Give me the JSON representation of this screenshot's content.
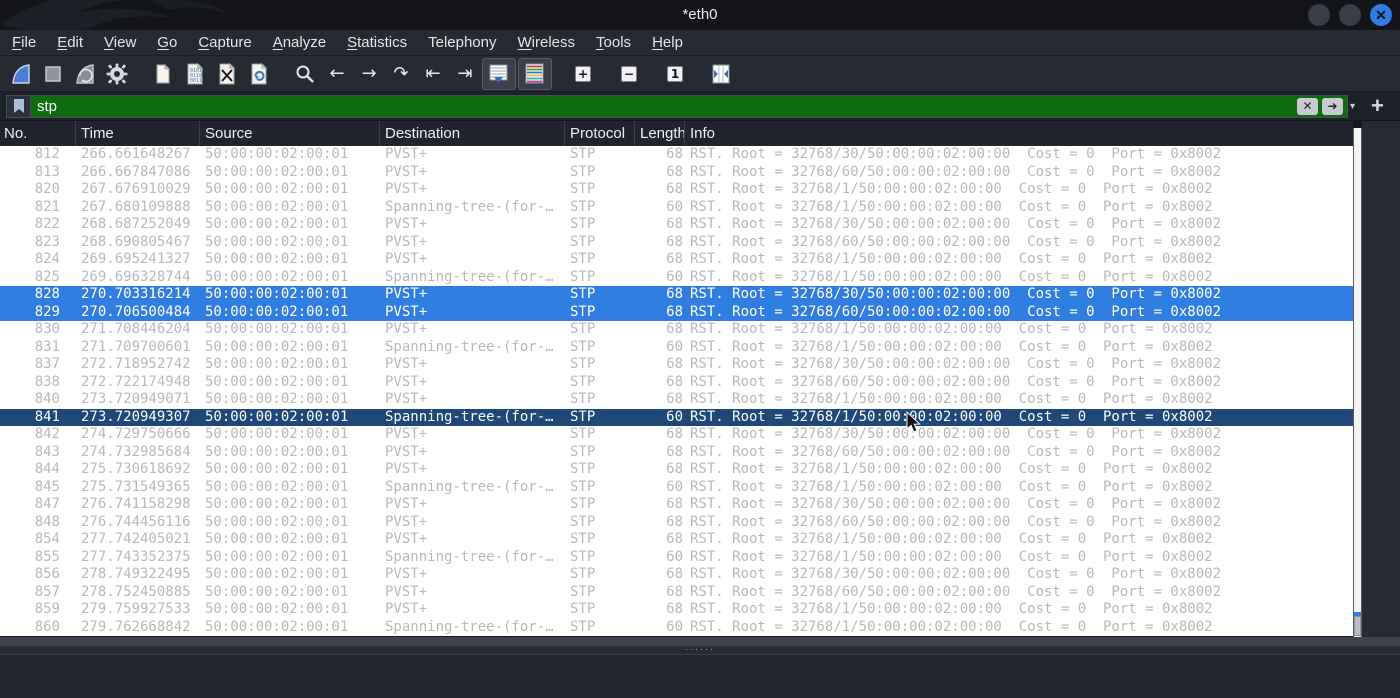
{
  "colors": {
    "selection_blue": "#2f7de1",
    "selection_inactive_blue": "#1d4878",
    "filter_valid_green": "#0e6b0e",
    "row_text_gray": "#b9b9b9",
    "chrome_dark": "#262a33",
    "list_background": "#ffffff"
  },
  "window": {
    "title": "*eth0",
    "close_glyph": "✕"
  },
  "menu": {
    "items": [
      {
        "head": "F",
        "tail": "ile",
        "headClass": "mn-u"
      },
      {
        "head": "E",
        "tail": "dit",
        "headClass": "mn-u"
      },
      {
        "head": "V",
        "tail": "iew",
        "headClass": "mn-u"
      },
      {
        "head": "G",
        "tail": "o",
        "headClass": "mn-u"
      },
      {
        "head": "C",
        "tail": "apture",
        "headClass": "mn-u"
      },
      {
        "head": "A",
        "tail": "nalyze",
        "headClass": "mn-u"
      },
      {
        "head": "S",
        "tail": "tatistics",
        "headClass": "mn-u"
      },
      {
        "head": "T",
        "tail": "elephony",
        "headClass": ""
      },
      {
        "head": "W",
        "tail": "ireless",
        "headClass": "mn-u"
      },
      {
        "head": "T",
        "tail": "ools",
        "headClass": "mn-u"
      },
      {
        "head": "H",
        "tail": "elp",
        "headClass": "mn-u"
      }
    ]
  },
  "toolbar": {
    "icons": [
      "start-capture-shark-fin",
      "stop-capture",
      "restart-capture-shark-fin",
      "capture-options-gear",
      "open-file",
      "save-file",
      "close-file",
      "reload-file",
      "find-packet-magnifier",
      "go-back",
      "go-forward",
      "go-to-packet",
      "go-first-packet",
      "go-last-packet",
      "auto-scroll",
      "colorize-packets",
      "zoom-in",
      "zoom-out",
      "normal-size",
      "resize-columns"
    ],
    "glyphs": {
      "back": "←",
      "forward": "→",
      "goto": "↷",
      "first": "⇤",
      "last": "⇥",
      "zoom_in": "+",
      "zoom_out": "−",
      "normal": "1"
    }
  },
  "filter": {
    "value": "stp",
    "clear_glyph": "✕",
    "apply_glyph": "➜",
    "chevron_glyph": "▾",
    "add_button_glyph": "+"
  },
  "table": {
    "columns": [
      "No.",
      "Time",
      "Source",
      "Destination",
      "Protocol",
      "Length",
      "Info"
    ],
    "rows": [
      {
        "cls": "prow pgrid",
        "no": "812",
        "time": "266.661648267",
        "src": "50:00:00:02:00:01",
        "dst": "PVST+",
        "proto": "STP",
        "len": "68",
        "info": "RST. Root = 32768/30/50:00:00:02:00:00  Cost = 0  Port = 0x8002"
      },
      {
        "cls": "prow pgrid",
        "no": "813",
        "time": "266.667847086",
        "src": "50:00:00:02:00:01",
        "dst": "PVST+",
        "proto": "STP",
        "len": "68",
        "info": "RST. Root = 32768/60/50:00:00:02:00:00  Cost = 0  Port = 0x8002"
      },
      {
        "cls": "prow pgrid",
        "no": "820",
        "time": "267.676910029",
        "src": "50:00:00:02:00:01",
        "dst": "PVST+",
        "proto": "STP",
        "len": "68",
        "info": "RST. Root = 32768/1/50:00:00:02:00:00  Cost = 0  Port = 0x8002"
      },
      {
        "cls": "prow pgrid",
        "no": "821",
        "time": "267.680109888",
        "src": "50:00:00:02:00:01",
        "dst": "Spanning-tree-(for-…",
        "proto": "STP",
        "len": "60",
        "info": "RST. Root = 32768/1/50:00:00:02:00:00  Cost = 0  Port = 0x8002"
      },
      {
        "cls": "prow pgrid",
        "no": "822",
        "time": "268.687252049",
        "src": "50:00:00:02:00:01",
        "dst": "PVST+",
        "proto": "STP",
        "len": "68",
        "info": "RST. Root = 32768/30/50:00:00:02:00:00  Cost = 0  Port = 0x8002"
      },
      {
        "cls": "prow pgrid",
        "no": "823",
        "time": "268.690805467",
        "src": "50:00:00:02:00:01",
        "dst": "PVST+",
        "proto": "STP",
        "len": "68",
        "info": "RST. Root = 32768/60/50:00:00:02:00:00  Cost = 0  Port = 0x8002"
      },
      {
        "cls": "prow pgrid",
        "no": "824",
        "time": "269.695241327",
        "src": "50:00:00:02:00:01",
        "dst": "PVST+",
        "proto": "STP",
        "len": "68",
        "info": "RST. Root = 32768/1/50:00:00:02:00:00  Cost = 0  Port = 0x8002"
      },
      {
        "cls": "prow pgrid",
        "no": "825",
        "time": "269.696328744",
        "src": "50:00:00:02:00:01",
        "dst": "Spanning-tree-(for-…",
        "proto": "STP",
        "len": "60",
        "info": "RST. Root = 32768/1/50:00:00:02:00:00  Cost = 0  Port = 0x8002"
      },
      {
        "cls": "prow pgrid sel",
        "no": "828",
        "time": "270.703316214",
        "src": "50:00:00:02:00:01",
        "dst": "PVST+",
        "proto": "STP",
        "len": "68",
        "info": "RST. Root = 32768/30/50:00:00:02:00:00  Cost = 0  Port = 0x8002"
      },
      {
        "cls": "prow pgrid sel",
        "no": "829",
        "time": "270.706500484",
        "src": "50:00:00:02:00:01",
        "dst": "PVST+",
        "proto": "STP",
        "len": "68",
        "info": "RST. Root = 32768/60/50:00:00:02:00:00  Cost = 0  Port = 0x8002"
      },
      {
        "cls": "prow pgrid",
        "no": "830",
        "time": "271.708446204",
        "src": "50:00:00:02:00:01",
        "dst": "PVST+",
        "proto": "STP",
        "len": "68",
        "info": "RST. Root = 32768/1/50:00:00:02:00:00  Cost = 0  Port = 0x8002"
      },
      {
        "cls": "prow pgrid",
        "no": "831",
        "time": "271.709700601",
        "src": "50:00:00:02:00:01",
        "dst": "Spanning-tree-(for-…",
        "proto": "STP",
        "len": "60",
        "info": "RST. Root = 32768/1/50:00:00:02:00:00  Cost = 0  Port = 0x8002"
      },
      {
        "cls": "prow pgrid",
        "no": "837",
        "time": "272.718952742",
        "src": "50:00:00:02:00:01",
        "dst": "PVST+",
        "proto": "STP",
        "len": "68",
        "info": "RST. Root = 32768/30/50:00:00:02:00:00  Cost = 0  Port = 0x8002"
      },
      {
        "cls": "prow pgrid",
        "no": "838",
        "time": "272.722174948",
        "src": "50:00:00:02:00:01",
        "dst": "PVST+",
        "proto": "STP",
        "len": "68",
        "info": "RST. Root = 32768/60/50:00:00:02:00:00  Cost = 0  Port = 0x8002"
      },
      {
        "cls": "prow pgrid",
        "no": "840",
        "time": "273.720949071",
        "src": "50:00:00:02:00:01",
        "dst": "PVST+",
        "proto": "STP",
        "len": "68",
        "info": "RST. Root = 32768/1/50:00:00:02:00:00  Cost = 0  Port = 0x8002"
      },
      {
        "cls": "prow pgrid seldark",
        "no": "841",
        "time": "273.720949307",
        "src": "50:00:00:02:00:01",
        "dst": "Spanning-tree-(for-…",
        "proto": "STP",
        "len": "60",
        "info": "RST. Root = 32768/1/50:00:00:02:00:00  Cost = 0  Port = 0x8002"
      },
      {
        "cls": "prow pgrid",
        "no": "842",
        "time": "274.729750666",
        "src": "50:00:00:02:00:01",
        "dst": "PVST+",
        "proto": "STP",
        "len": "68",
        "info": "RST. Root = 32768/30/50:00:00:02:00:00  Cost = 0  Port = 0x8002"
      },
      {
        "cls": "prow pgrid",
        "no": "843",
        "time": "274.732985684",
        "src": "50:00:00:02:00:01",
        "dst": "PVST+",
        "proto": "STP",
        "len": "68",
        "info": "RST. Root = 32768/60/50:00:00:02:00:00  Cost = 0  Port = 0x8002"
      },
      {
        "cls": "prow pgrid",
        "no": "844",
        "time": "275.730618692",
        "src": "50:00:00:02:00:01",
        "dst": "PVST+",
        "proto": "STP",
        "len": "68",
        "info": "RST. Root = 32768/1/50:00:00:02:00:00  Cost = 0  Port = 0x8002"
      },
      {
        "cls": "prow pgrid",
        "no": "845",
        "time": "275.731549365",
        "src": "50:00:00:02:00:01",
        "dst": "Spanning-tree-(for-…",
        "proto": "STP",
        "len": "60",
        "info": "RST. Root = 32768/1/50:00:00:02:00:00  Cost = 0  Port = 0x8002"
      },
      {
        "cls": "prow pgrid",
        "no": "847",
        "time": "276.741158298",
        "src": "50:00:00:02:00:01",
        "dst": "PVST+",
        "proto": "STP",
        "len": "68",
        "info": "RST. Root = 32768/30/50:00:00:02:00:00  Cost = 0  Port = 0x8002"
      },
      {
        "cls": "prow pgrid",
        "no": "848",
        "time": "276.744456116",
        "src": "50:00:00:02:00:01",
        "dst": "PVST+",
        "proto": "STP",
        "len": "68",
        "info": "RST. Root = 32768/60/50:00:00:02:00:00  Cost = 0  Port = 0x8002"
      },
      {
        "cls": "prow pgrid",
        "no": "854",
        "time": "277.742405021",
        "src": "50:00:00:02:00:01",
        "dst": "PVST+",
        "proto": "STP",
        "len": "68",
        "info": "RST. Root = 32768/1/50:00:00:02:00:00  Cost = 0  Port = 0x8002"
      },
      {
        "cls": "prow pgrid",
        "no": "855",
        "time": "277.743352375",
        "src": "50:00:00:02:00:01",
        "dst": "Spanning-tree-(for-…",
        "proto": "STP",
        "len": "60",
        "info": "RST. Root = 32768/1/50:00:00:02:00:00  Cost = 0  Port = 0x8002"
      },
      {
        "cls": "prow pgrid",
        "no": "856",
        "time": "278.749322495",
        "src": "50:00:00:02:00:01",
        "dst": "PVST+",
        "proto": "STP",
        "len": "68",
        "info": "RST. Root = 32768/30/50:00:00:02:00:00  Cost = 0  Port = 0x8002"
      },
      {
        "cls": "prow pgrid",
        "no": "857",
        "time": "278.752450885",
        "src": "50:00:00:02:00:01",
        "dst": "PVST+",
        "proto": "STP",
        "len": "68",
        "info": "RST. Root = 32768/60/50:00:00:02:00:00  Cost = 0  Port = 0x8002"
      },
      {
        "cls": "prow pgrid",
        "no": "859",
        "time": "279.759927533",
        "src": "50:00:00:02:00:01",
        "dst": "PVST+",
        "proto": "STP",
        "len": "68",
        "info": "RST. Root = 32768/1/50:00:00:02:00:00  Cost = 0  Port = 0x8002"
      },
      {
        "cls": "prow pgrid",
        "no": "860",
        "time": "279.762668842",
        "src": "50:00:00:02:00:01",
        "dst": "Spanning-tree-(for-…",
        "proto": "STP",
        "len": "60",
        "info": "RST. Root = 32768/1/50:00:00:02:00:00  Cost = 0  Port = 0x8002"
      }
    ]
  },
  "splitter": {
    "dots": "······"
  }
}
